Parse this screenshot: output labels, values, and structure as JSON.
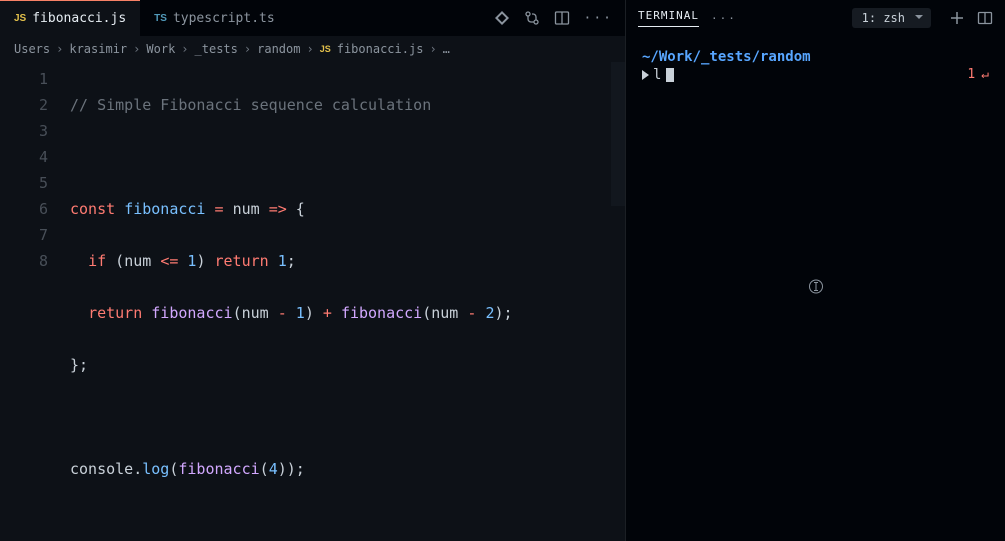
{
  "tabs": {
    "items": [
      {
        "icon": "JS",
        "label": "fibonacci.js",
        "active": true
      },
      {
        "icon": "TS",
        "label": "typescript.ts",
        "active": false
      }
    ]
  },
  "breadcrumb": {
    "parts": [
      "Users",
      "krasimir",
      "Work",
      "_tests",
      "random"
    ],
    "file_icon": "JS",
    "file": "fibonacci.js",
    "trailing": "…"
  },
  "code": {
    "lines": [
      {
        "n": "1",
        "raw": "// Simple Fibonacci sequence calculation"
      },
      {
        "n": "2",
        "raw": ""
      },
      {
        "n": "3",
        "raw": "const fibonacci = num => {"
      },
      {
        "n": "4",
        "raw": "  if (num <= 1) return 1;"
      },
      {
        "n": "5",
        "raw": "  return fibonacci(num - 1) + fibonacci(num - 2);"
      },
      {
        "n": "6",
        "raw": "};"
      },
      {
        "n": "7",
        "raw": ""
      },
      {
        "n": "8",
        "raw": "console.log(fibonacci(4));"
      }
    ],
    "tokens": {
      "l1": {
        "comment": "// Simple Fibonacci sequence calculation"
      },
      "l3": {
        "kw_const": "const",
        "ident": "fibonacci",
        "eq": "=",
        "arg": "num",
        "arrow": "=>",
        "brace": "{"
      },
      "l4": {
        "kw_if": "if",
        "open": "(",
        "ident": "num",
        "op": "<=",
        "num1": "1",
        "close": ")",
        "kw_ret": "return",
        "num2": "1",
        "semi": ";"
      },
      "l5": {
        "kw_ret": "return",
        "fn": "fibonacci",
        "o1": "(",
        "a1": "num",
        "op1": "-",
        "n1": "1",
        "c1": ")",
        "plus": "+",
        "o2": "(",
        "a2": "num",
        "op2": "-",
        "n2": "2",
        "c2": ")",
        "semi": ";"
      },
      "l6": {
        "brace": "};"
      },
      "l8": {
        "obj": "console",
        "dot": ".",
        "method": "log",
        "o": "(",
        "fn": "fibonacci",
        "o2": "(",
        "n": "4",
        "c2": ")",
        "c": ")",
        "semi": ";"
      }
    }
  },
  "terminal": {
    "tab_label": "TERMINAL",
    "more": "···",
    "selector": "1: zsh",
    "cwd": "~/Work/_tests/random",
    "command": "l",
    "status_code": "1",
    "status_symbol": "↵"
  }
}
